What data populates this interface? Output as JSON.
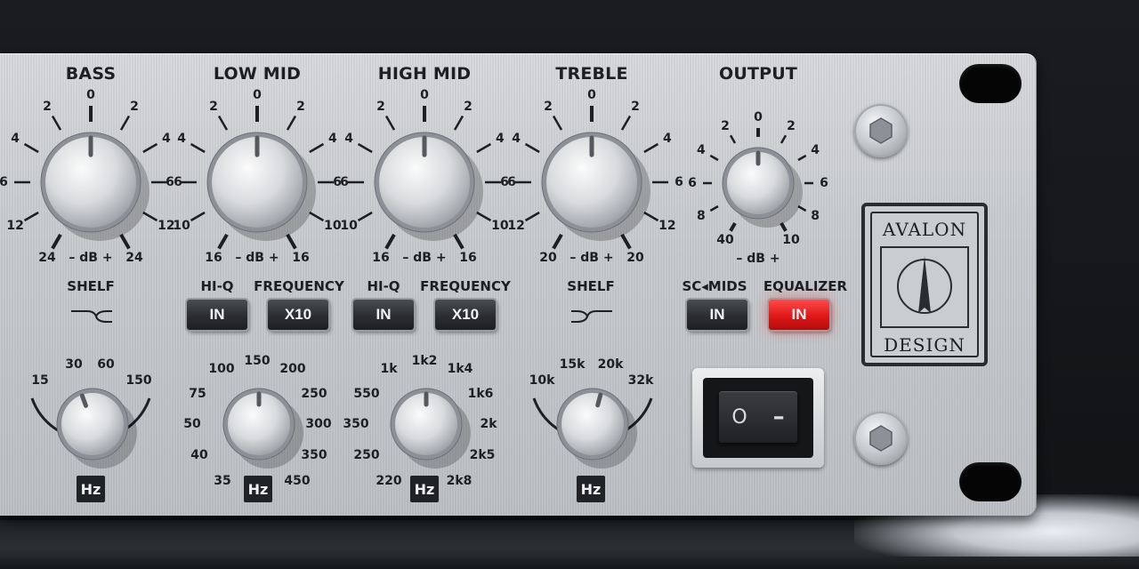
{
  "brand": {
    "top": "AVALON",
    "bottom": "DESIGN"
  },
  "colors": {
    "panel": "#c9ccd0",
    "ink": "#1d1f22",
    "button": "#2b2d31",
    "button_active": "#e01818"
  },
  "gain_knobs": [
    {
      "id": "bass",
      "title": "BASS",
      "unit": "– dB +",
      "left": [
        "24",
        "12",
        "6",
        "4",
        "2"
      ],
      "top": "0",
      "right": [
        "2",
        "4",
        "6",
        "12",
        "24"
      ]
    },
    {
      "id": "low-mid",
      "title": "LOW MID",
      "unit": "– dB +",
      "left": [
        "16",
        "10",
        "6",
        "4",
        "2"
      ],
      "top": "0",
      "right": [
        "2",
        "4",
        "6",
        "10",
        "16"
      ]
    },
    {
      "id": "high-mid",
      "title": "HIGH MID",
      "unit": "– dB +",
      "left": [
        "16",
        "10",
        "6",
        "4",
        "2"
      ],
      "top": "0",
      "right": [
        "2",
        "4",
        "6",
        "10",
        "16"
      ]
    },
    {
      "id": "treble",
      "title": "TREBLE",
      "unit": "– dB +",
      "left": [
        "20",
        "12",
        "6",
        "4",
        "2"
      ],
      "top": "0",
      "right": [
        "2",
        "4",
        "6",
        "12",
        "20"
      ]
    },
    {
      "id": "output",
      "title": "OUTPUT",
      "unit": "– dB +",
      "left": [
        "40",
        "8",
        "6",
        "4",
        "2"
      ],
      "top": "0",
      "right": [
        "2",
        "4",
        "6",
        "8",
        "10"
      ]
    }
  ],
  "controls": {
    "bass_shelf_label": "SHELF",
    "treble_shelf_label": "SHELF",
    "lowmid_hiq_label": "HI-Q",
    "lowmid_freq_label": "FREQUENCY",
    "highmid_hiq_label": "HI-Q",
    "highmid_freq_label": "FREQUENCY",
    "sc_mids_label": "SC◂MIDS",
    "equalizer_label": "EQUALIZER",
    "lowmid_hiq_button": "IN",
    "lowmid_x10_button": "X10",
    "highmid_hiq_button": "IN",
    "highmid_x10_button": "X10",
    "sc_mids_button": "IN",
    "equalizer_button": "IN"
  },
  "freq_knobs": [
    {
      "id": "bass-freq",
      "unit": "Hz",
      "ticks": [
        "15",
        "30",
        "60",
        "150"
      ]
    },
    {
      "id": "lowmid-freq",
      "unit": "Hz",
      "ticks": [
        "35",
        "40",
        "50",
        "75",
        "100",
        "150",
        "200",
        "250",
        "300",
        "350",
        "450"
      ]
    },
    {
      "id": "highmid-freq",
      "unit": "Hz",
      "ticks": [
        "220",
        "250",
        "350",
        "550",
        "1k",
        "1k2",
        "1k4",
        "1k6",
        "2k",
        "2k5",
        "2k8"
      ]
    },
    {
      "id": "treble-freq",
      "unit": "Hz",
      "ticks": [
        "10k",
        "15k",
        "20k",
        "32k"
      ]
    }
  ],
  "power_switch": {
    "off_symbol": "O",
    "on_symbol": "–"
  }
}
